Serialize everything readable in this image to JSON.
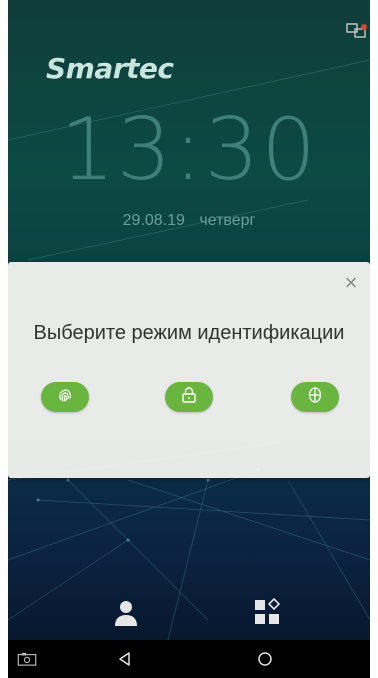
{
  "status": {
    "network_icon": "network-status-icon"
  },
  "brand": {
    "logo_text": "Smartec"
  },
  "clock": {
    "time": "13:30",
    "date": "29.08.19",
    "weekday": "четверг"
  },
  "dialog": {
    "title": "Выберите режим идентификации",
    "close_label": "×",
    "modes": [
      {
        "icon": "fingerprint-icon"
      },
      {
        "icon": "lock-icon"
      },
      {
        "icon": "face-icon"
      }
    ]
  },
  "dock": {
    "user_icon": "user-icon",
    "apps_icon": "apps-icon"
  },
  "navbar": {
    "items": [
      "screenshot-icon",
      "back-icon",
      "home-icon"
    ]
  },
  "colors": {
    "accent_green": "#6ab53f",
    "background": "#0c4a44",
    "dialog_bg": "#f6f6f2"
  }
}
